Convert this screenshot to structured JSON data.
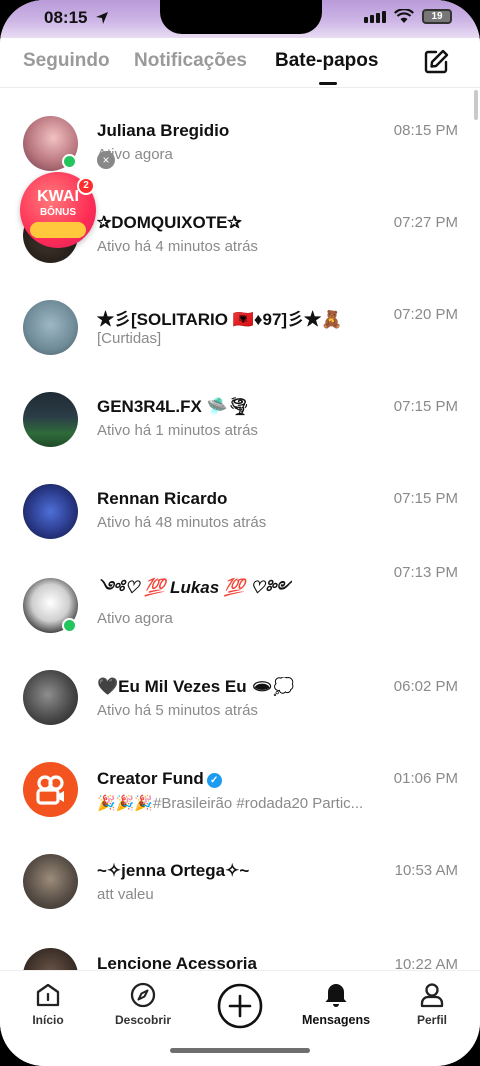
{
  "status_bar": {
    "time": "08:15",
    "battery": "19"
  },
  "tabs": [
    {
      "label": "Seguindo"
    },
    {
      "label": "Notificações"
    },
    {
      "label": "Bate-papos"
    }
  ],
  "conversations": [
    {
      "name": "Juliana Bregidio",
      "subtitle": "Ativo agora",
      "time": "08:15 PM"
    },
    {
      "name": "✰DOMQUIXOTE✰",
      "subtitle": "Ativo há 4 minutos atrás",
      "time": "07:27 PM"
    },
    {
      "name": "★彡[SOLITARIO 🇦🇱♦97]彡★🧸",
      "subtitle": "[Curtidas]",
      "time": "07:20 PM"
    },
    {
      "name": "GEN3R4L.FX 🛸🌪",
      "subtitle": "Ativo há 1 minutos atrás",
      "time": "07:15 PM"
    },
    {
      "name": "Rennan Ricardo",
      "subtitle": "Ativo há 48 minutos atrás",
      "time": "07:15 PM"
    },
    {
      "name": "༺♡ 💯 Lukas 💯 ♡༻",
      "subtitle": "Ativo agora",
      "time": "07:13 PM"
    },
    {
      "name": "🖤Eu Mil Vezes Eu 🕳💭",
      "subtitle": "Ativo há 5 minutos atrás",
      "time": "06:02 PM"
    },
    {
      "name": "Creator Fund",
      "subtitle": "🎉🎉🎉#Brasileirão #rodada20 Partic...",
      "time": "01:06 PM"
    },
    {
      "name": "~✧jenna Ortega✧~",
      "subtitle": "att valeu",
      "time": "10:53 AM"
    },
    {
      "name": "Lencione Acessoria",
      "subtitle": "",
      "time": "10:22 AM"
    }
  ],
  "kwai_bonus": {
    "line1": "KWAI",
    "line2": "BÔNUS",
    "badge": "2",
    "close": "×"
  },
  "verified_mark": "✓",
  "bottom_nav": [
    {
      "label": "Início"
    },
    {
      "label": "Descobrir"
    },
    {
      "label": ""
    },
    {
      "label": "Mensagens"
    },
    {
      "label": "Perfil"
    }
  ]
}
